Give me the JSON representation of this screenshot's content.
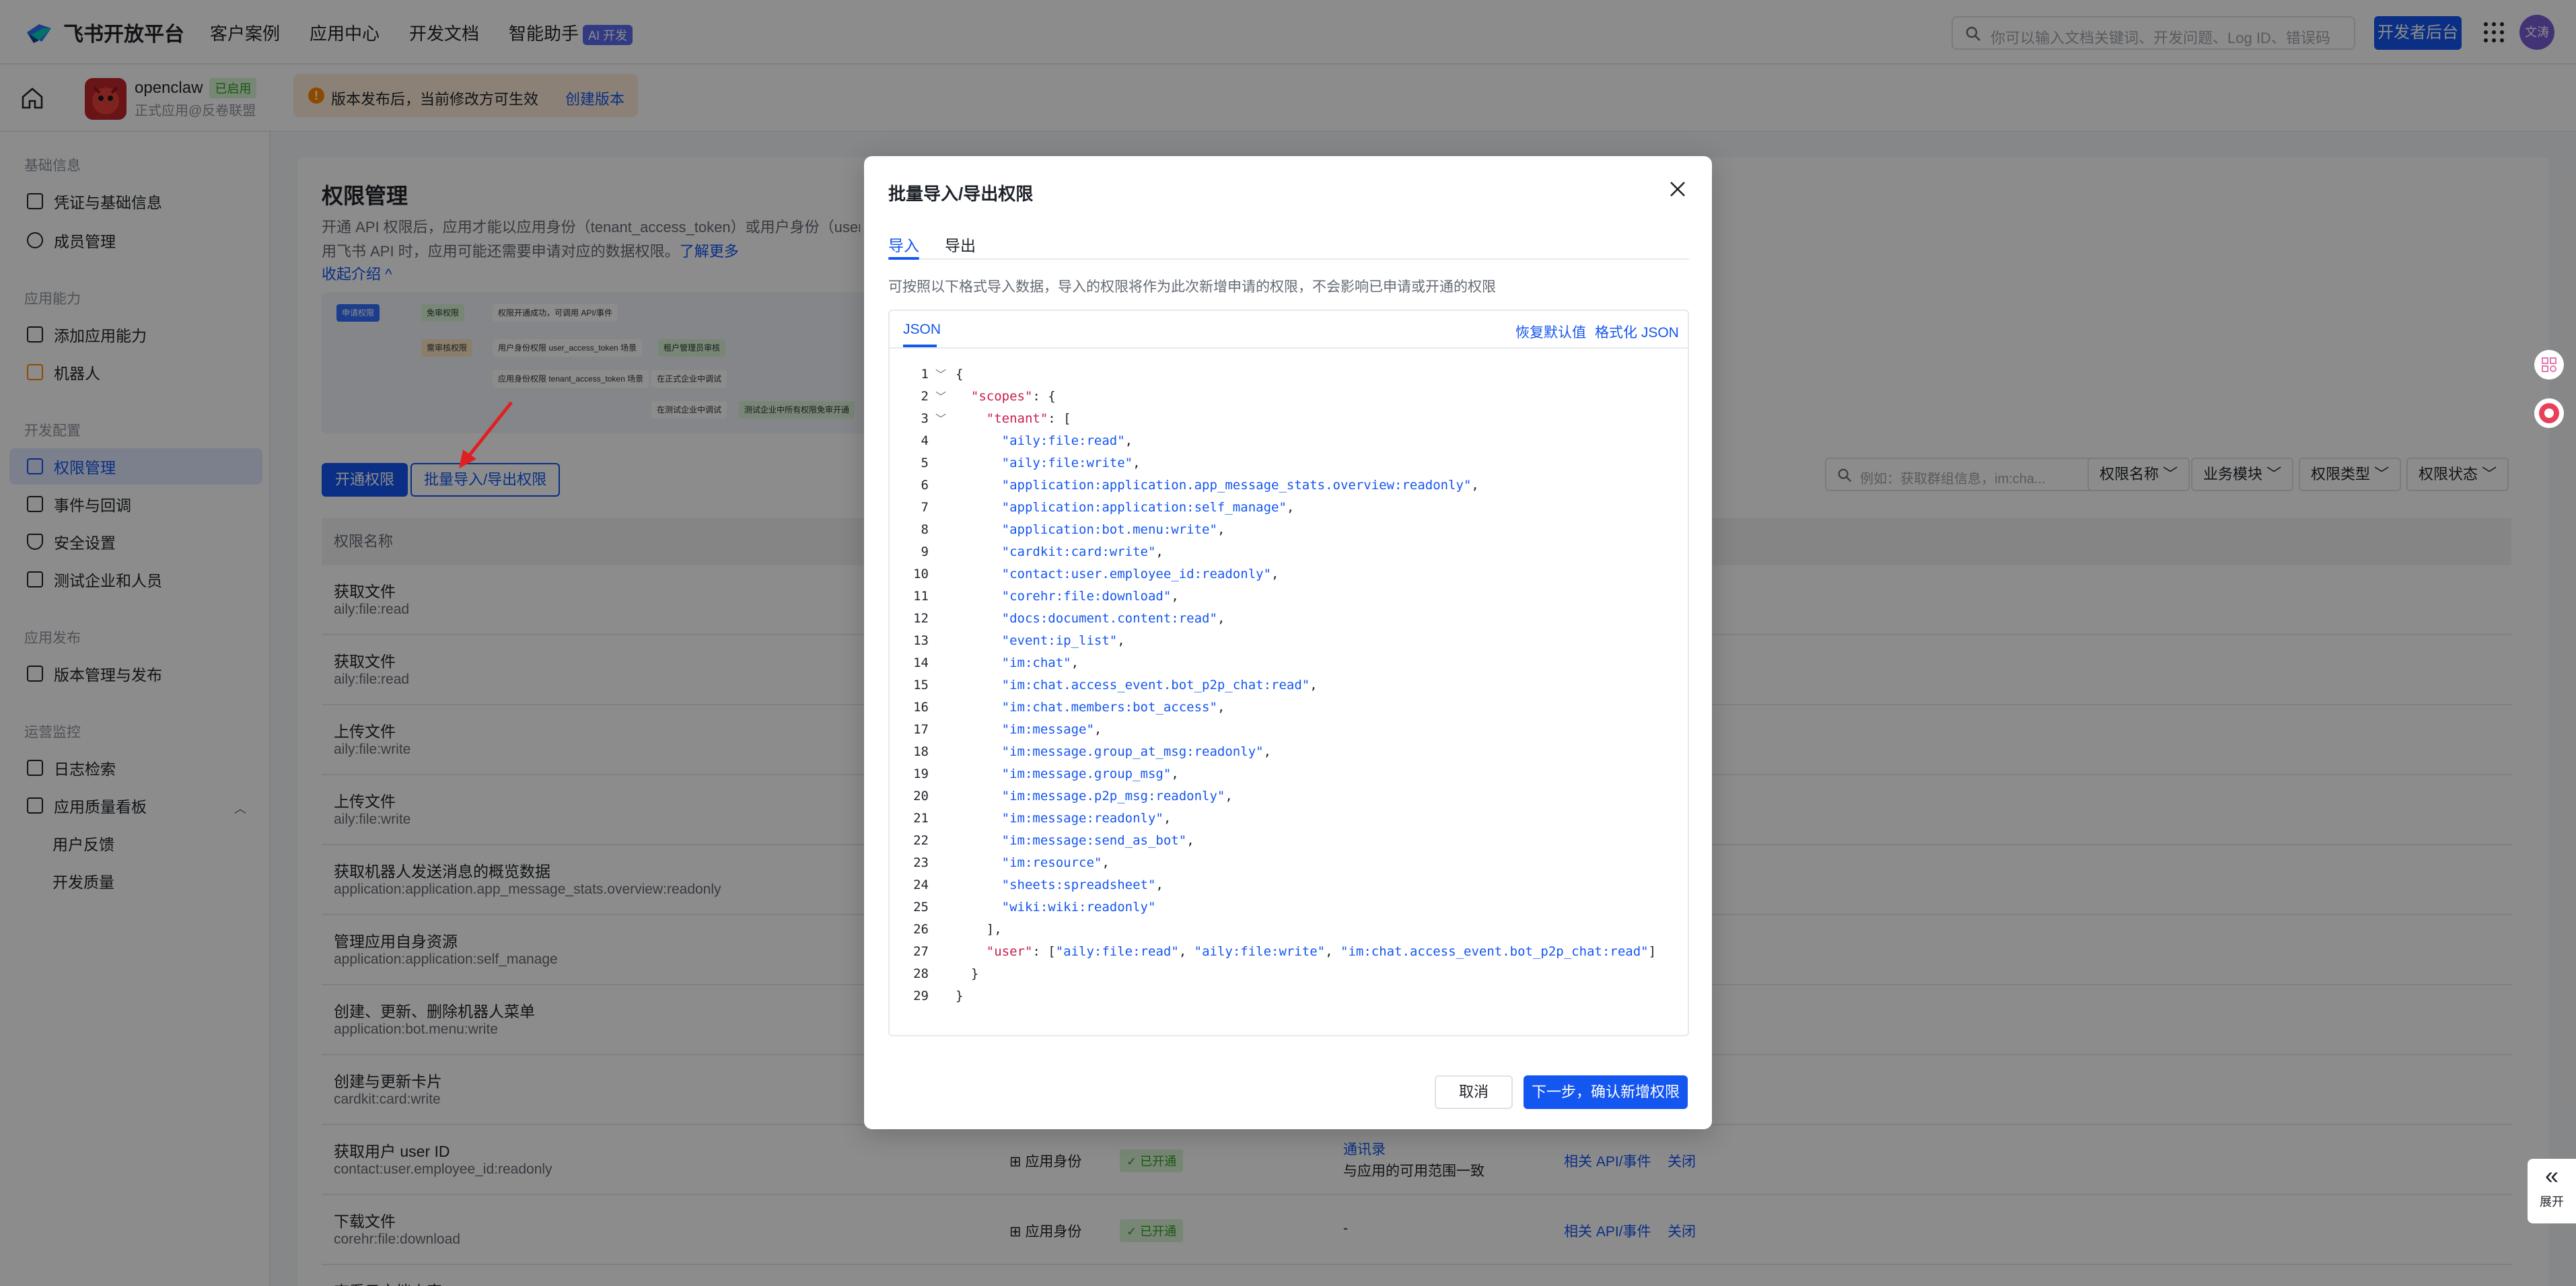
{
  "topbar": {
    "brand": "飞书开放平台",
    "nav": [
      "客户案例",
      "应用中心",
      "开发文档",
      "智能助手"
    ],
    "ai_badge": "AI 开发",
    "search_placeholder": "你可以输入文档关键词、开发问题、Log ID、错误码",
    "dev_button": "开发者后台",
    "user_avatar": "文涛"
  },
  "app_header": {
    "app_name": "openclaw",
    "app_badge": "已启用",
    "app_org": "正式应用@反卷联盟",
    "notice_text": "版本发布后，当前修改方可生效",
    "notice_link": "创建版本"
  },
  "sidebar": {
    "sections": [
      {
        "title": "基础信息",
        "items": [
          "凭证与基础信息",
          "成员管理"
        ]
      },
      {
        "title": "应用能力",
        "items": [
          "添加应用能力",
          "机器人"
        ]
      },
      {
        "title": "开发配置",
        "items": [
          "权限管理",
          "事件与回调",
          "安全设置",
          "测试企业和人员"
        ]
      },
      {
        "title": "应用发布",
        "items": [
          "版本管理与发布"
        ]
      },
      {
        "title": "运营监控",
        "items": [
          "日志检索",
          "应用质量看板",
          "用户反馈",
          "开发质量"
        ]
      }
    ],
    "active_item": "权限管理"
  },
  "main": {
    "title": "权限管理",
    "desc_line1": "开通 API 权限后，应用才能以应用身份（tenant_access_token）或用户身份（user_access",
    "desc_line2": "用飞书 API 时，应用可能还需要申请对应的数据权限。",
    "desc_link": "了解更多",
    "collapse": "收起介绍 ^",
    "diagram_labels": [
      "申请权限",
      "免审权限",
      "权限开通成功，可调用 API/事件",
      "需审核权限",
      "用户身份权限 user_access_token 场景",
      "租户管理员审核",
      "应用身份权限 tenant_access_token 场景",
      "在正式企业中调试",
      "在测试企业中调试",
      "测试企业中所有权限免审开通"
    ],
    "btn_open": "开通权限",
    "btn_batch": "批量导入/导出权限",
    "filter_placeholder": "例如：获取群组信息，im:cha...",
    "filters": [
      "权限名称",
      "业务模块",
      "权限类型",
      "权限状态"
    ],
    "table_header": "权限名称",
    "rows": [
      {
        "name": "获取文件",
        "code": "aily:file:read"
      },
      {
        "name": "获取文件",
        "code": "aily:file:read"
      },
      {
        "name": "上传文件",
        "code": "aily:file:write"
      },
      {
        "name": "上传文件",
        "code": "aily:file:write"
      },
      {
        "name": "获取机器人发送消息的概览数据",
        "code": "application:application.app_message_stats.overview:readonly"
      },
      {
        "name": "管理应用自身资源",
        "code": "application:application:self_manage"
      },
      {
        "name": "创建、更新、删除机器人菜单",
        "code": "application:bot.menu:write"
      },
      {
        "name": "创建与更新卡片",
        "code": "cardkit:card:write"
      },
      {
        "name": "获取用户 user ID",
        "code": "contact:user.employee_id:readonly",
        "type": "应用身份",
        "status": "已开通",
        "range1": "通讯录",
        "range2": "与应用的可用范围一致",
        "api": "相关 API/事件",
        "close": "关闭"
      },
      {
        "name": "下载文件",
        "code": "corehr:file:download",
        "type": "应用身份",
        "status": "已开通",
        "range1": "-",
        "api": "相关 API/事件",
        "close": "关闭"
      },
      {
        "name": "查看云文档内容",
        "code": ""
      }
    ]
  },
  "modal": {
    "title": "批量导入/导出权限",
    "tabs": [
      "导入",
      "导出"
    ],
    "hint": "可按照以下格式导入数据，导入的权限将作为此次新增申请的权限，不会影响已申请或开通的权限",
    "editor_tab": "JSON",
    "reset": "恢复默认值",
    "format": "格式化 JSON",
    "code_lines": [
      "{",
      "  \"scopes\": {",
      "    \"tenant\": [",
      "      \"aily:file:read\",",
      "      \"aily:file:write\",",
      "      \"application:application.app_message_stats.overview:readonly\",",
      "      \"application:application:self_manage\",",
      "      \"application:bot.menu:write\",",
      "      \"cardkit:card:write\",",
      "      \"contact:user.employee_id:readonly\",",
      "      \"corehr:file:download\",",
      "      \"docs:document.content:read\",",
      "      \"event:ip_list\",",
      "      \"im:chat\",",
      "      \"im:chat.access_event.bot_p2p_chat:read\",",
      "      \"im:chat.members:bot_access\",",
      "      \"im:message\",",
      "      \"im:message.group_at_msg:readonly\",",
      "      \"im:message.group_msg\",",
      "      \"im:message.p2p_msg:readonly\",",
      "      \"im:message:readonly\",",
      "      \"im:message:send_as_bot\",",
      "      \"im:resource\",",
      "      \"sheets:spreadsheet\",",
      "      \"wiki:wiki:readonly\"",
      "    ],",
      "    \"user\": [\"aily:file:read\", \"aily:file:write\", \"im:chat.access_event.bot_p2p_chat:read\"]",
      "  }",
      "}"
    ],
    "cancel": "取消",
    "next": "下一步，确认新增权限"
  },
  "expand_label": "展开"
}
